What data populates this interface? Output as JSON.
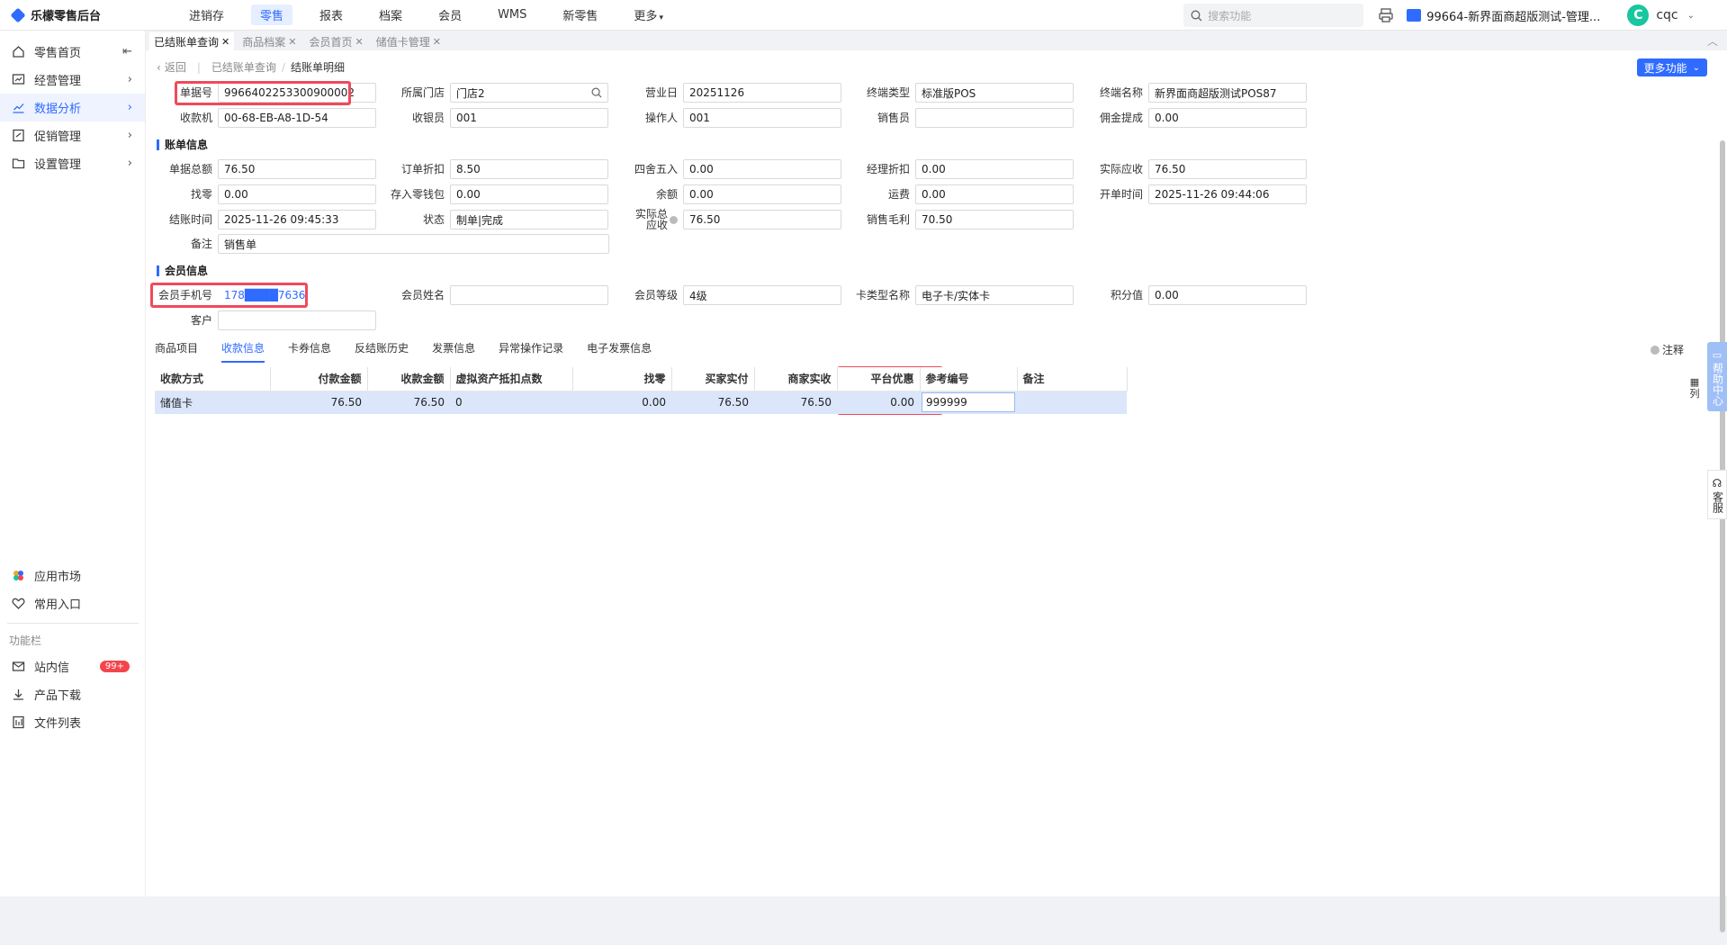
{
  "app": {
    "title": "乐檬零售后台"
  },
  "topnav": [
    "进销存",
    "零售",
    "报表",
    "档案",
    "会员",
    "WMS",
    "新零售",
    "更多"
  ],
  "search": {
    "placeholder": "搜索功能"
  },
  "store": {
    "name": "99664-新界面商超版测试-管理..."
  },
  "user": {
    "initial": "C",
    "name": "cqc"
  },
  "sidebar": {
    "items": [
      {
        "label": "零售首页",
        "icon": "home-icon"
      },
      {
        "label": "经营管理",
        "icon": "chart-board-icon"
      },
      {
        "label": "数据分析",
        "icon": "trend-icon"
      },
      {
        "label": "促销管理",
        "icon": "promo-icon"
      },
      {
        "label": "设置管理",
        "icon": "folder-icon"
      }
    ],
    "bottom": {
      "app_market": "应用市场",
      "favorites": "常用入口",
      "section": "功能栏",
      "inbox": "站内信",
      "inbox_badge": "99+",
      "download": "产品下载",
      "files": "文件列表"
    }
  },
  "tabs": [
    "已结账单查询",
    "商品档案",
    "会员首页",
    "储值卡管理"
  ],
  "breadcrumb": {
    "back": "返回",
    "parent": "已结账单查询",
    "current": "结账单明细"
  },
  "more_button": "更多功能",
  "basic": {
    "bill_no_label": "单据号",
    "bill_no": "9966402253300900002",
    "store_label": "所属门店",
    "store": "门店2",
    "biz_day_label": "营业日",
    "biz_day": "20251126",
    "terminal_type_label": "终端类型",
    "terminal_type": "标准版POS",
    "terminal_name_label": "终端名称",
    "terminal_name": "新界面商超版测试POS87",
    "pos_label": "收款机",
    "pos": "00-68-EB-A8-1D-54",
    "cashier_label": "收银员",
    "cashier": "001",
    "operator_label": "操作人",
    "operator": "001",
    "seller_label": "销售员",
    "seller": "",
    "commission_label": "佣金提成",
    "commission": "0.00"
  },
  "bill_section": "账单信息",
  "bill": {
    "total_label": "单据总额",
    "total": "76.50",
    "discount_label": "订单折扣",
    "discount": "8.50",
    "rounding_label": "四舍五入",
    "rounding": "0.00",
    "mgr_discount_label": "经理折扣",
    "mgr_discount": "0.00",
    "receivable_label": "实际应收",
    "receivable": "76.50",
    "change_label": "找零",
    "change": "0.00",
    "wallet_label": "存入零钱包",
    "wallet": "0.00",
    "balance_label": "余额",
    "balance": "0.00",
    "freight_label": "运费",
    "freight": "0.00",
    "open_time_label": "开单时间",
    "open_time": "2025-11-26 09:44:06",
    "close_time_label": "结账时间",
    "close_time": "2025-11-26 09:45:33",
    "status_label": "状态",
    "status": "制单|完成",
    "actual_total_label": "实际总应收",
    "actual_total": "76.50",
    "profit_label": "销售毛利",
    "profit": "70.50",
    "remark_label": "备注",
    "remark": "销售单"
  },
  "member_section": "会员信息",
  "member": {
    "phone_label": "会员手机号",
    "phone": "178████7636",
    "name_label": "会员姓名",
    "name": "",
    "level_label": "会员等级",
    "level": "4级",
    "card_type_label": "卡类型名称",
    "card_type": "电子卡/实体卡",
    "points_label": "积分值",
    "points": "0.00",
    "customer_label": "客户",
    "customer": ""
  },
  "subtabs": [
    "商品项目",
    "收款信息",
    "卡券信息",
    "反结账历史",
    "发票信息",
    "异常操作记录",
    "电子发票信息"
  ],
  "note_label": "注释",
  "payment_table": {
    "headers": [
      "收款方式",
      "付款金额",
      "收款金额",
      "虚拟资产抵扣点数",
      "找零",
      "买家实付",
      "商家实收",
      "平台优惠",
      "参考编号",
      "备注"
    ],
    "rows": [
      [
        "储值卡",
        "76.50",
        "76.50",
        "0",
        "0.00",
        "76.50",
        "76.50",
        "0.00",
        "999999",
        ""
      ]
    ]
  },
  "column_toggle": "列",
  "help_center": "帮助中心",
  "customer_service": "客服"
}
